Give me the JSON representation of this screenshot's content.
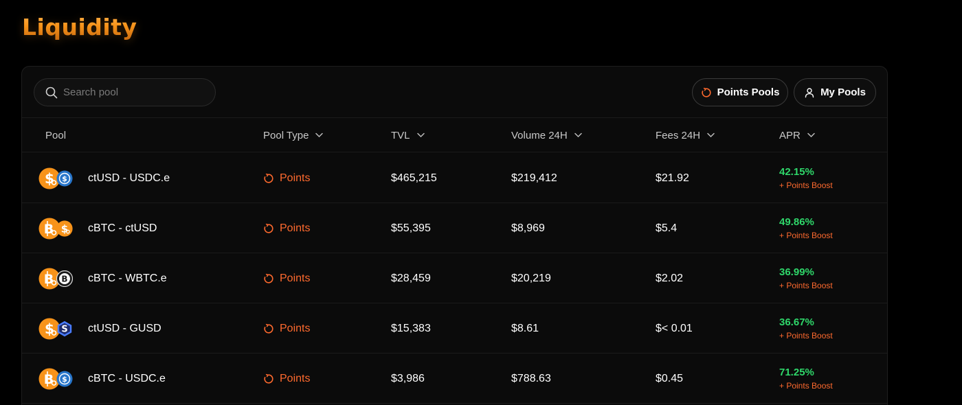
{
  "header": {
    "title": "Liquidity"
  },
  "toolbar": {
    "search_placeholder": "Search pool",
    "search_value": "",
    "points_pools_label": "Points Pools",
    "my_pools_label": "My Pools"
  },
  "table": {
    "columns": {
      "pool": "Pool",
      "pool_type": "Pool Type",
      "tvl": "TVL",
      "volume": "Volume 24H",
      "fees": "Fees 24H",
      "apr": "APR"
    },
    "rows": [
      {
        "pair": "ctUSD - USDC.e",
        "type": "Points",
        "tvl": "$465,215",
        "volume": "$219,412",
        "fees": "$21.92",
        "apr": "42.15%",
        "boost": "+ Points Boost",
        "tokens": [
          "ctusd-icon",
          "usdc-icon"
        ]
      },
      {
        "pair": "cBTC - ctUSD",
        "type": "Points",
        "tvl": "$55,395",
        "volume": "$8,969",
        "fees": "$5.4",
        "apr": "49.86%",
        "boost": "+ Points Boost",
        "tokens": [
          "cbtc-icon",
          "ctusd-icon"
        ]
      },
      {
        "pair": "cBTC - WBTC.e",
        "type": "Points",
        "tvl": "$28,459",
        "volume": "$20,219",
        "fees": "$2.02",
        "apr": "36.99%",
        "boost": "+ Points Boost",
        "tokens": [
          "cbtc-icon",
          "wbtc-icon"
        ]
      },
      {
        "pair": "ctUSD - GUSD",
        "type": "Points",
        "tvl": "$15,383",
        "volume": "$8.61",
        "fees": "$< 0.01",
        "apr": "36.67%",
        "boost": "+ Points Boost",
        "tokens": [
          "ctusd-icon",
          "gusd-icon"
        ]
      },
      {
        "pair": "cBTC - USDC.e",
        "type": "Points",
        "tvl": "$3,986",
        "volume": "$788.63",
        "fees": "$0.45",
        "apr": "71.25%",
        "boost": "+ Points Boost",
        "tokens": [
          "cbtc-icon",
          "usdc-icon"
        ]
      }
    ]
  },
  "colors": {
    "accent_orange": "#f7931a",
    "points_orange": "#ff6a2e",
    "apr_green": "#2fd76a",
    "usdc_blue": "#2775ca",
    "gusd_blue": "#4a7dff"
  }
}
